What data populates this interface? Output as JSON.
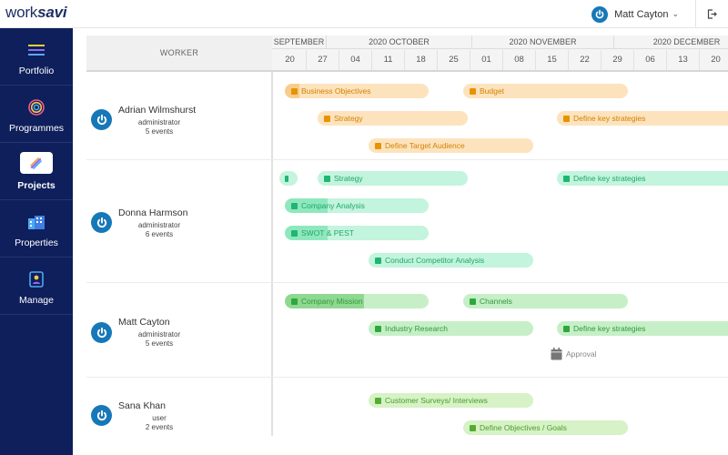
{
  "app": {
    "logo_work": "work",
    "logo_savi": "savi"
  },
  "header": {
    "user_name": "Matt Cayton"
  },
  "sidebar": {
    "items": [
      {
        "label": "Portfolio",
        "icon": "list-icon",
        "active": false
      },
      {
        "label": "Programmes",
        "icon": "target-icon",
        "active": false
      },
      {
        "label": "Projects",
        "icon": "pen-icon",
        "active": true
      },
      {
        "label": "Properties",
        "icon": "building-icon",
        "active": false
      },
      {
        "label": "Manage",
        "icon": "id-card-icon",
        "active": false
      }
    ]
  },
  "timeline": {
    "worker_header": "WORKER",
    "months": [
      "SEPTEMBER",
      "2020 OCTOBER",
      "2020 NOVEMBER",
      "2020 DECEMBER"
    ],
    "days": [
      "20",
      "27",
      "04",
      "11",
      "18",
      "25",
      "01",
      "08",
      "15",
      "22",
      "29",
      "06",
      "13",
      "20"
    ]
  },
  "workers": [
    {
      "name": "Adrian Wilmshurst",
      "role": "administrator",
      "events": "5 events",
      "tasks": [
        {
          "label": "Business Objectives",
          "color": "orange",
          "progress": 0.1
        },
        {
          "label": "Budget",
          "color": "orange",
          "progress": 0
        },
        {
          "label": "Strategy",
          "color": "orange",
          "progress": 0
        },
        {
          "label": "Define key strategies",
          "color": "orange",
          "progress": 0
        },
        {
          "label": "Define Target Audience",
          "color": "orange",
          "progress": 0
        }
      ]
    },
    {
      "name": "Donna Harmson",
      "role": "administrator",
      "events": "6 events",
      "tasks": [
        {
          "label": "",
          "color": "teal",
          "progress": 0
        },
        {
          "label": "Strategy",
          "color": "teal",
          "progress": 0
        },
        {
          "label": "Define key strategies",
          "color": "teal",
          "progress": 0
        },
        {
          "label": "Company Analysis",
          "color": "teal",
          "progress": 0.3
        },
        {
          "label": "SWOT & PEST",
          "color": "teal",
          "progress": 0.3
        },
        {
          "label": "Conduct Competitor Analysis",
          "color": "teal",
          "progress": 0
        }
      ]
    },
    {
      "name": "Matt Cayton",
      "role": "administrator",
      "events": "5 events",
      "tasks": [
        {
          "label": "Company Mission",
          "color": "green",
          "progress": 0.55
        },
        {
          "label": "Channels",
          "color": "green",
          "progress": 0
        },
        {
          "label": "Industry Research",
          "color": "green",
          "progress": 0
        },
        {
          "label": "Define key strategies",
          "color": "green",
          "progress": 0
        },
        {
          "label": "Approval",
          "color": "milestone",
          "progress": 0
        }
      ]
    },
    {
      "name": "Sana Khan",
      "role": "user",
      "events": "2 events",
      "tasks": [
        {
          "label": "Customer Surveys/ Interviews",
          "color": "lime",
          "progress": 0
        },
        {
          "label": "Define Objectives / Goals",
          "color": "lime",
          "progress": 0
        }
      ]
    }
  ]
}
